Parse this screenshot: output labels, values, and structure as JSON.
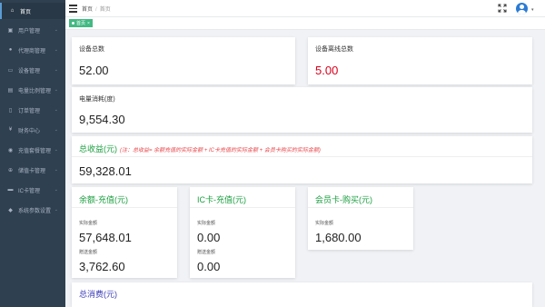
{
  "sidebar": {
    "items": [
      {
        "label": "首页",
        "icon": "home-icon",
        "active": true
      },
      {
        "label": "用户管理",
        "icon": "user-icon"
      },
      {
        "label": "代理商管理",
        "icon": "agent-icon"
      },
      {
        "label": "设备管理",
        "icon": "device-icon"
      },
      {
        "label": "电量比例管理",
        "icon": "power-icon"
      },
      {
        "label": "订单管理",
        "icon": "order-icon"
      },
      {
        "label": "财务中心",
        "icon": "finance-icon"
      },
      {
        "label": "充值套餐管理",
        "icon": "package-icon"
      },
      {
        "label": "储值卡管理",
        "icon": "card-icon"
      },
      {
        "label": "IC卡管理",
        "icon": "ic-card-icon"
      },
      {
        "label": "系统参数设置",
        "icon": "settings-icon"
      }
    ]
  },
  "header": {
    "breadcrumb": {
      "home": "首页",
      "separator": "/",
      "current": "首页"
    }
  },
  "tags": {
    "active_tag": "首页",
    "close": "×"
  },
  "stats": {
    "device_total": {
      "title": "设备总数",
      "value": "52.00"
    },
    "device_offline": {
      "title": "设备离线总数",
      "value": "5.00"
    },
    "power": {
      "title": "电量消耗(度)",
      "value": "9,554.30"
    },
    "income": {
      "title": "总收益(元)",
      "note": "(注：总收益= 余额充值的实际金额 + IC卡充值的实际金额 + 会员卡购买的实际金额)",
      "value": "59,328.01"
    },
    "balance": {
      "title": "余额-充值(元)",
      "actual_label": "实际金额",
      "actual_value": "57,648.01",
      "gift_label": "赠送金额",
      "gift_value": "3,762.60"
    },
    "ic_card": {
      "title": "IC卡-充值(元)",
      "actual_label": "实际金额",
      "actual_value": "0.00",
      "gift_label": "赠送金额",
      "gift_value": "0.00"
    },
    "member": {
      "title": "会员卡-购买(元)",
      "actual_label": "实际金额",
      "actual_value": "1,680.00"
    },
    "consume": {
      "title": "总消费(元)"
    }
  },
  "colors": {
    "accent_green": "#1a9e3f",
    "alert_red": "#d9001b",
    "tag_green": "#42b983",
    "sidebar_bg": "#2f4050"
  }
}
